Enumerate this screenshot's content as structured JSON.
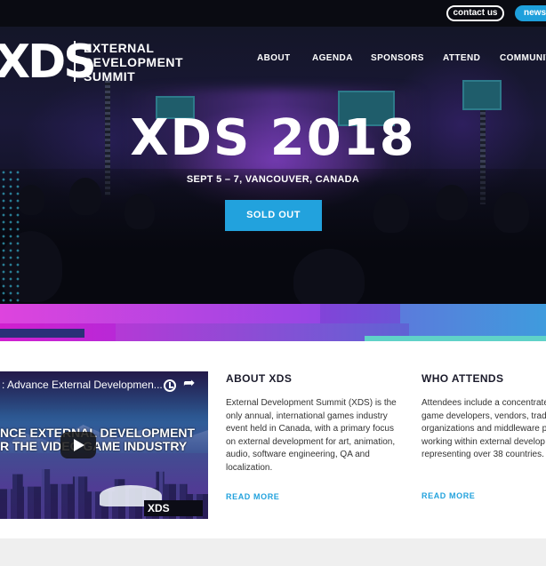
{
  "topbar": {
    "contact_label": "contact us",
    "newsletter_label": "newsletter"
  },
  "brand": {
    "logo_mark": "XDS",
    "name_line1": "EXTERNAL",
    "name_line2": "DEVELOPMENT",
    "name_line3": "SUMMIT"
  },
  "nav": {
    "items": [
      {
        "label": "ABOUT"
      },
      {
        "label": "AGENDA"
      },
      {
        "label": "SPONSORS"
      },
      {
        "label": "ATTEND"
      },
      {
        "label": "COMMUNITY"
      }
    ]
  },
  "hero": {
    "title": "XDS 2018",
    "subtitle": "SEPT 5 – 7, VANCOUVER, CANADA",
    "cta_label": "SOLD OUT"
  },
  "video": {
    "title": ": Advance External Developmen...",
    "overlay_line1": "NCE EXTERNAL DEVELOPMENT",
    "overlay_line2": "R THE VIDEO GAME INDUSTRY",
    "logo": "XDS",
    "icons": [
      "clock-icon",
      "share-icon",
      "play-icon"
    ]
  },
  "about": {
    "title": "ABOUT XDS",
    "lines": [
      "External Development Summit (XDS) is the",
      "only annual, international games industry",
      "event held in Canada, with a primary focus",
      "on external development for art, animation,",
      "audio, software engineering, QA and",
      "localization."
    ],
    "read_more": "READ MORE"
  },
  "attends": {
    "title": "WHO ATTENDS",
    "lines": [
      "Attendees include a concentrated",
      "game developers, vendors, trade",
      "organizations and middleware p",
      "working within external develop",
      "representing over 38 countries."
    ],
    "read_more": "READ MORE"
  },
  "colors": {
    "accent_blue": "#22a2dd",
    "band_magenta": "#d11fd0",
    "band_teal": "#5fd2c8",
    "topbar_bg": "#0a0b12"
  }
}
